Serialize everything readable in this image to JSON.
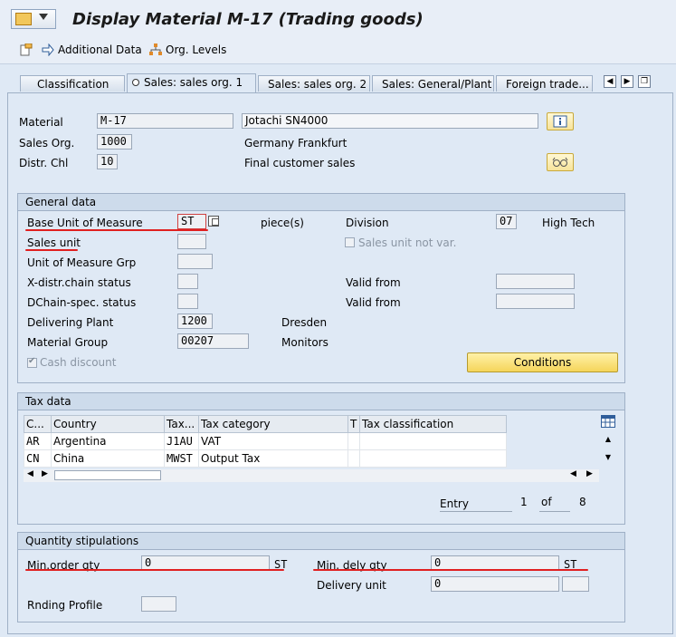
{
  "window": {
    "title": "Display Material M-17 (Trading goods)"
  },
  "toolbar": {
    "additional_data": "Additional Data",
    "org_levels": "Org. Levels"
  },
  "tabs": [
    "Classification",
    "Sales: sales org. 1",
    "Sales: sales org. 2",
    "Sales: General/Plant",
    "Foreign trade..."
  ],
  "header": {
    "material_label": "Material",
    "material_value": "M-17",
    "material_desc": "Jotachi SN4000",
    "sales_org_label": "Sales Org.",
    "sales_org_value": "1000",
    "sales_org_desc": "Germany Frankfurt",
    "distr_chl_label": "Distr. Chl",
    "distr_chl_value": "10",
    "distr_chl_desc": "Final customer sales"
  },
  "general": {
    "title": "General data",
    "base_uom_label": "Base Unit of Measure",
    "base_uom_value": "ST",
    "base_uom_desc": "piece(s)",
    "division_label": "Division",
    "division_value": "07",
    "division_desc": "High Tech",
    "sales_unit_label": "Sales unit",
    "sales_unit_not_var_label": "Sales unit not var.",
    "uom_grp_label": "Unit of Measure Grp",
    "xdistr_label": "X-distr.chain status",
    "valid_from_1_label": "Valid from",
    "dchain_label": "DChain-spec. status",
    "valid_from_2_label": "Valid from",
    "deliv_plant_label": "Delivering Plant",
    "deliv_plant_value": "1200",
    "deliv_plant_desc": "Dresden",
    "mat_group_label": "Material Group",
    "mat_group_value": "00207",
    "mat_group_desc": "Monitors",
    "cash_discount_label": "Cash discount",
    "conditions_button": "Conditions"
  },
  "tax": {
    "title": "Tax data",
    "columns": [
      "C...",
      "Country",
      "Tax...",
      "Tax category",
      "T",
      "Tax classification"
    ],
    "rows": [
      [
        "AR",
        "Argentina",
        "J1AU",
        "VAT",
        "",
        ""
      ],
      [
        "CN",
        "China",
        "MWST",
        "Output Tax",
        "",
        ""
      ]
    ],
    "entry_label": "Entry",
    "entry_value": "1",
    "of_label": "of",
    "total_value": "8"
  },
  "qty": {
    "title": "Quantity stipulations",
    "min_order_label": "Min.order qty",
    "min_order_value": "0",
    "min_order_unit": "ST",
    "min_dely_label": "Min. dely qty",
    "min_dely_value": "0",
    "min_dely_unit": "ST",
    "delivery_unit_label": "Delivery unit",
    "delivery_unit_value": "0",
    "rnd_profile_label": "Rnding Profile"
  },
  "colors": {
    "background": "#dfe9f5",
    "annotation": "#e02020",
    "button": "#f5d55a"
  }
}
